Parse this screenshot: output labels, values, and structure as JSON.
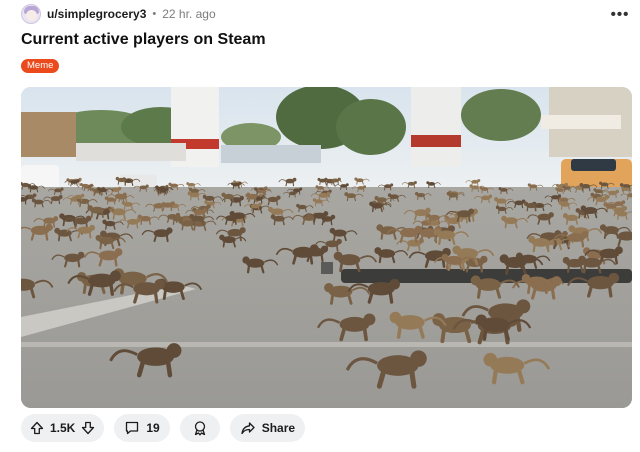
{
  "post": {
    "username": "u/simplegrocery3",
    "separator": "•",
    "timestamp": "22 hr. ago",
    "more_label": "•••",
    "title": "Current active players on Steam",
    "flair": "Meme"
  },
  "actions": {
    "upvotes": "1.5K",
    "comments": "19",
    "share_label": "Share"
  },
  "colors": {
    "flair_bg": "#ea4a1c",
    "pill_bg": "#eef0f2"
  },
  "icons": [
    "avatar",
    "more-icon",
    "upvote-icon",
    "downvote-icon",
    "comment-icon",
    "award-icon",
    "share-icon"
  ]
}
